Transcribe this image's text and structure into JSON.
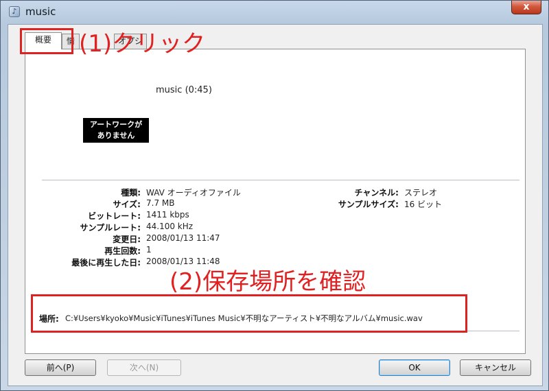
{
  "window": {
    "title": "music",
    "app_icon": "music-note-icon",
    "close_label": "x"
  },
  "tabs": [
    {
      "label": "概要",
      "active": true
    },
    {
      "label": "情",
      "active": false
    },
    {
      "label": "オプシ",
      "active": false
    }
  ],
  "summary": {
    "track_title": "music (0:45)",
    "artwork_line1": "アートワークが",
    "artwork_line2": "ありません"
  },
  "info_left": [
    {
      "label": "種類:",
      "value": "WAV オーディオファイル"
    },
    {
      "label": "サイズ:",
      "value": "7.7 MB"
    },
    {
      "label": "ビットレート:",
      "value": "1411 kbps"
    },
    {
      "label": "サンプルレート:",
      "value": "44.100 kHz"
    },
    {
      "label": "変更日:",
      "value": "2008/01/13 11:47"
    },
    {
      "label": "再生回数:",
      "value": "1"
    },
    {
      "label": "最後に再生した日:",
      "value": "2008/01/13 11:48"
    }
  ],
  "info_right": [
    {
      "label": "チャンネル:",
      "value": "ステレオ"
    },
    {
      "label": "サンプルサイズ:",
      "value": "16 ビット"
    }
  ],
  "location": {
    "label": "場所:",
    "value": "C:¥Users¥kyoko¥Music¥iTunes¥iTunes Music¥不明なアーティスト¥不明なアルバム¥music.wav"
  },
  "buttons": {
    "prev": "前へ(P)",
    "next": "次へ(N)",
    "ok": "OK",
    "cancel": "キャンセル"
  },
  "annotations": {
    "step1": "(1)クリック",
    "step2": "(2)保存場所を確認",
    "color": "#e02121"
  }
}
